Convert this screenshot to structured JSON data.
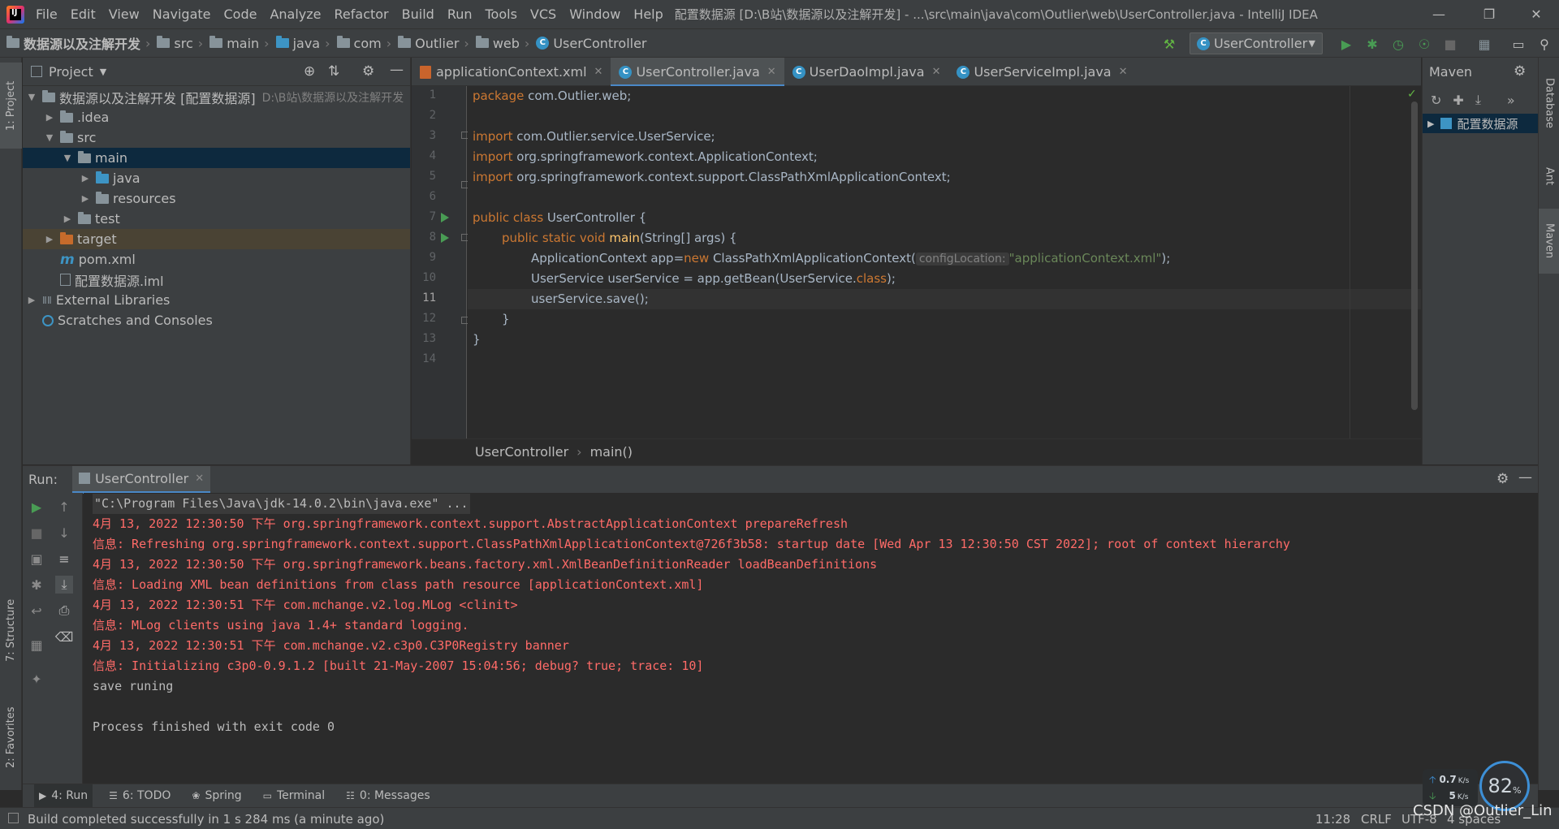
{
  "window": {
    "menu": [
      "File",
      "Edit",
      "View",
      "Navigate",
      "Code",
      "Analyze",
      "Refactor",
      "Build",
      "Run",
      "Tools",
      "VCS",
      "Window",
      "Help"
    ],
    "title": "配置数据源 [D:\\B站\\数据源以及注解开发] - ...\\src\\main\\java\\com\\Outlier\\web\\UserController.java - IntelliJ IDEA"
  },
  "breadcrumb": [
    "数据源以及注解开发",
    "src",
    "main",
    "java",
    "com",
    "Outlier",
    "web",
    "UserController"
  ],
  "run_config": "UserController",
  "side_tabs": {
    "project": "1: Project",
    "structure": "7: Structure",
    "favorites": "2: Favorites",
    "database": "Database",
    "ant": "Ant",
    "maven": "Maven"
  },
  "project": {
    "header": "Project",
    "tree": [
      {
        "label": "数据源以及注解开发 [配置数据源]",
        "extra": "D:\\B站\\数据源以及注解开发",
        "depth": 0,
        "arrow": "open",
        "icon": "folder"
      },
      {
        "label": ".idea",
        "depth": 1,
        "arrow": "closed",
        "icon": "folder"
      },
      {
        "label": "src",
        "depth": 1,
        "arrow": "open",
        "icon": "folder"
      },
      {
        "label": "main",
        "depth": 2,
        "arrow": "open",
        "icon": "folder",
        "selected": true
      },
      {
        "label": "java",
        "depth": 3,
        "arrow": "closed",
        "icon": "folder-blue"
      },
      {
        "label": "resources",
        "depth": 3,
        "arrow": "closed",
        "icon": "folder"
      },
      {
        "label": "test",
        "depth": 2,
        "arrow": "closed",
        "icon": "folder"
      },
      {
        "label": "target",
        "depth": 1,
        "arrow": "closed",
        "icon": "folder-orange",
        "excluded": true
      },
      {
        "label": "pom.xml",
        "depth": 1,
        "arrow": "none",
        "icon": "maven-m"
      },
      {
        "label": "配置数据源.iml",
        "depth": 1,
        "arrow": "none",
        "icon": "iml-file"
      },
      {
        "label": "External Libraries",
        "depth": 0,
        "arrow": "closed",
        "icon": "libraries"
      },
      {
        "label": "Scratches and Consoles",
        "depth": 0,
        "arrow": "none",
        "icon": "scratches"
      }
    ]
  },
  "editor": {
    "tabs": [
      {
        "label": "applicationContext.xml",
        "icon": "xml-file",
        "active": false
      },
      {
        "label": "UserController.java",
        "icon": "class",
        "active": true
      },
      {
        "label": "UserDaoImpl.java",
        "icon": "class",
        "active": false
      },
      {
        "label": "UserServiceImpl.java",
        "icon": "class",
        "active": false
      }
    ],
    "line_numbers": [
      "1",
      "2",
      "3",
      "4",
      "5",
      "6",
      "7",
      "8",
      "9",
      "10",
      "11",
      "12",
      "13",
      "14"
    ],
    "code": {
      "l1_kw": "package",
      "l1_rest": " com.Outlier.web;",
      "l3_kw": "import",
      "l3_rest": " com.Outlier.service.UserService;",
      "l4_kw": "import",
      "l4_rest": " org.springframework.context.ApplicationContext;",
      "l5_kw": "import",
      "l5_rest": " org.springframework.context.support.ClassPathXmlApplicationContext;",
      "l7_kw": "public class",
      "l7_rest": " UserController {",
      "l8_kw": "public static void",
      "l8_fn": "main",
      "l8_rest": "(String[] args) {",
      "l9_a": "ApplicationContext app=",
      "l9_kw": "new",
      "l9_b": " ClassPathXmlApplicationContext(",
      "l9_hint": "configLocation:",
      "l9_str": "\"applicationContext.xml\"",
      "l9_c": ");",
      "l10_a": "UserService userService = app.getBean(UserService.",
      "l10_kw": "class",
      "l10_b": ");",
      "l11": "userService.save();",
      "l12": "}",
      "l13": "}"
    },
    "crumbs": [
      "UserController",
      "main()"
    ]
  },
  "maven": {
    "header": "Maven",
    "project": "配置数据源"
  },
  "run": {
    "label": "Run:",
    "tab": "UserController",
    "console": [
      {
        "text": "\"C:\\Program Files\\Java\\jdk-14.0.2\\bin\\java.exe\" ...",
        "err": false
      },
      {
        "text": "4月 13, 2022 12:30:50 下午 org.springframework.context.support.AbstractApplicationContext prepareRefresh",
        "err": true
      },
      {
        "text": "信息: Refreshing org.springframework.context.support.ClassPathXmlApplicationContext@726f3b58: startup date [Wed Apr 13 12:30:50 CST 2022]; root of context hierarchy",
        "err": true
      },
      {
        "text": "4月 13, 2022 12:30:50 下午 org.springframework.beans.factory.xml.XmlBeanDefinitionReader loadBeanDefinitions",
        "err": true
      },
      {
        "text": "信息: Loading XML bean definitions from class path resource [applicationContext.xml]",
        "err": true
      },
      {
        "text": "4月 13, 2022 12:30:51 下午 com.mchange.v2.log.MLog <clinit>",
        "err": true
      },
      {
        "text": "信息: MLog clients using java 1.4+ standard logging.",
        "err": true
      },
      {
        "text": "4月 13, 2022 12:30:51 下午 com.mchange.v2.c3p0.C3P0Registry banner",
        "err": true
      },
      {
        "text": "信息: Initializing c3p0-0.9.1.2 [built 21-May-2007 15:04:56; debug? true; trace: 10]",
        "err": true
      },
      {
        "text": "save runing",
        "err": false
      },
      {
        "text": "",
        "err": false
      },
      {
        "text": "Process finished with exit code 0",
        "err": false
      }
    ]
  },
  "bottom_tabs": [
    {
      "label": "4: Run",
      "active": true,
      "icon": "run-icon"
    },
    {
      "label": "6: TODO",
      "active": false,
      "icon": "todo-icon"
    },
    {
      "label": "Spring",
      "active": false,
      "icon": "spring-icon"
    },
    {
      "label": "Terminal",
      "active": false,
      "icon": "terminal-icon"
    },
    {
      "label": "0: Messages",
      "active": false,
      "icon": "messages-icon"
    }
  ],
  "status": {
    "message": "Build completed successfully in 1 s 284 ms (a minute ago)",
    "position": "11:28",
    "line_sep": "CRLF",
    "encoding": "UTF-8",
    "indent": "4 spaces"
  },
  "network": {
    "up": "0.7",
    "up_unit": "K/s",
    "down": "5",
    "down_unit": "K/s",
    "percent": "82",
    "percent_sign": "%"
  },
  "watermark": "CSDN @Outlier_Lin",
  "colors": {
    "accent": "#4a88c7",
    "keyword": "#cc7832",
    "string": "#6a8759",
    "error": "#ff6b68",
    "run": "#499c54"
  }
}
